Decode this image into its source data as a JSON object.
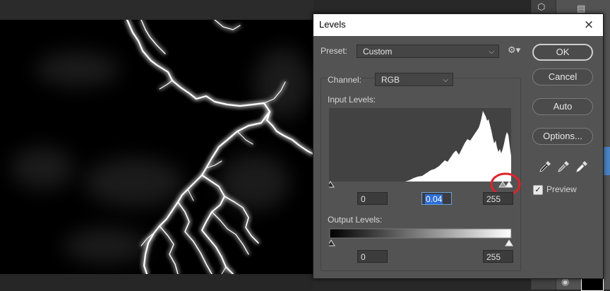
{
  "dialog": {
    "title": "Levels",
    "close_icon": "×",
    "preset_label": "Preset:",
    "preset_value": "Custom",
    "channel_label": "Channel:",
    "channel_value": "RGB",
    "input_levels_label": "Input Levels:",
    "output_levels_label": "Output Levels:",
    "input_black": "0",
    "input_gamma": "0.04",
    "input_white": "255",
    "output_black": "0",
    "output_white": "255",
    "buttons": {
      "ok": "OK",
      "cancel": "Cancel",
      "auto": "Auto",
      "options": "Options..."
    },
    "preview_label": "Preview",
    "preview_checked": "✓"
  },
  "colors": {
    "accent": "#2d6dd8",
    "highlight_circle": "#e0222a",
    "dialog_bg": "#535353"
  }
}
